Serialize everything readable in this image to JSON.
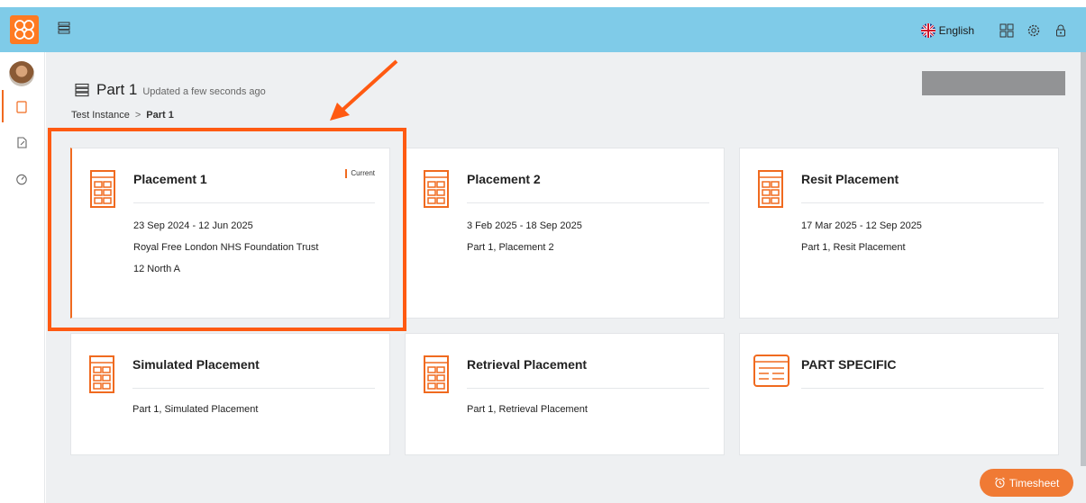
{
  "topbar": {
    "language": "English",
    "icons": [
      "menu-icon",
      "uk-flag-icon",
      "grid-icon",
      "settings-icon",
      "lock-icon"
    ],
    "bg_color": "#7fcbe8",
    "logo_color": "#ff7a22"
  },
  "sidebar": {
    "items": [
      {
        "name": "placements",
        "icon": "document-icon",
        "active": true
      },
      {
        "name": "notes",
        "icon": "edit-document-icon",
        "active": false
      },
      {
        "name": "progress",
        "icon": "timer-icon",
        "active": false
      }
    ]
  },
  "page": {
    "title": "Part 1",
    "updated": "Updated a few seconds ago",
    "breadcrumb": [
      "Test Instance",
      "Part 1"
    ],
    "breadcrumb_separator": ">"
  },
  "cards": [
    {
      "title": "Placement 1",
      "badge": "Current",
      "lines": [
        "23 Sep 2024 - 12 Jun 2025",
        "Royal Free London NHS Foundation Trust",
        "12 North A"
      ],
      "icon": "building-icon"
    },
    {
      "title": "Placement 2",
      "lines": [
        "3 Feb 2025 - 18 Sep 2025",
        "Part 1, Placement 2"
      ],
      "icon": "building-icon"
    },
    {
      "title": "Resit Placement",
      "lines": [
        "17 Mar 2025 - 12 Sep 2025",
        "Part 1, Resit Placement"
      ],
      "icon": "building-icon"
    },
    {
      "title": "Simulated Placement",
      "lines": [
        "Part 1, Simulated Placement"
      ],
      "icon": "building-icon"
    },
    {
      "title": "Retrieval Placement",
      "lines": [
        "Part 1, Retrieval Placement"
      ],
      "icon": "building-icon"
    },
    {
      "title": "PART SPECIFIC",
      "lines": [],
      "icon": "form-icon"
    }
  ],
  "timesheet": {
    "label": "Timesheet",
    "icon": "alarm-clock-icon",
    "color": "#f07a34"
  },
  "accent_color": "#f06a1f",
  "annotation_color": "#ff5a12"
}
